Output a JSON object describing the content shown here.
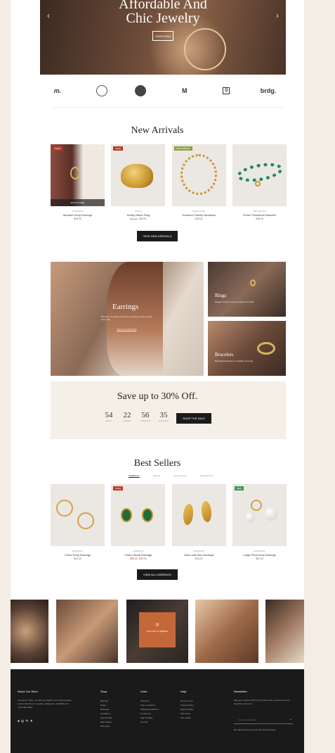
{
  "hero": {
    "title_line1": "Affordable And",
    "title_line2": "Chic Jewelry",
    "button": "SHOP NOW"
  },
  "brands": [
    "m.",
    "",
    "",
    "M",
    "D",
    "brdg."
  ],
  "new_arrivals": {
    "title": "New Arrivals",
    "products": [
      {
        "badge": "SALE",
        "badge_color": "#c0392b",
        "category": "EARRINGS",
        "name": "Medium Hoop Earrings",
        "price": "$35.00",
        "old_price": "",
        "quick": "ADD TO CART"
      },
      {
        "badge": "SALE",
        "badge_color": "#c0392b",
        "category": "RINGS",
        "name": "Smiley Wave Ring",
        "price": "$28.00",
        "old_price": "$32.00"
      },
      {
        "badge": "NEW ARRIVAL",
        "badge_color": "#8fa33a",
        "category": "NECKLACES",
        "name": "Textured Chunky Necklace",
        "price": "$45.00",
        "old_price": ""
      },
      {
        "badge": "",
        "badge_color": "",
        "category": "BRACELETS",
        "name": "Green Gemstone Bracelet",
        "price": "$38.00",
        "old_price": ""
      }
    ],
    "button": "VIEW NEW ARRIVALS"
  },
  "categories": {
    "big": {
      "label": "Earrings",
      "desc": "Discover our latest collection of earrings made to shine every day",
      "link": "SHOP COLLECTION"
    },
    "rings": {
      "label": "Rings",
      "desc": "Elegant rings for every occasion and style"
    },
    "bracelets": {
      "label": "Bracelets",
      "desc": "Beautiful bracelets to complete your look"
    }
  },
  "sale": {
    "title": "Save up to 30% Off.",
    "countdown": [
      {
        "n": "54",
        "u": "DAYS"
      },
      {
        "n": "22",
        "u": "HOURS"
      },
      {
        "n": "56",
        "u": "MINUTES"
      },
      {
        "n": "35",
        "u": "SECONDS"
      }
    ],
    "button": "SHOP THE SALE"
  },
  "best_sellers": {
    "title": "Best Sellers",
    "tabs": [
      "EARRINGS",
      "RINGS",
      "NECKLACES",
      "BRACELETS"
    ],
    "products": [
      {
        "badge": "",
        "badge_color": "",
        "category": "EARRINGS",
        "name": "Circle Hoop Earrings",
        "price": "$24.00",
        "old_price": ""
      },
      {
        "badge": "SALE",
        "badge_color": "#c0392b",
        "category": "EARRINGS",
        "name": "Green Stone Earrings",
        "price": "$30.00",
        "old_price": "$38.00"
      },
      {
        "badge": "",
        "badge_color": "",
        "category": "EARRINGS",
        "name": "Gold Leaf Stud Earrings",
        "price": "$26.00",
        "old_price": ""
      },
      {
        "badge": "NEW",
        "badge_color": "#3a9a5b",
        "category": "EARRINGS",
        "name": "Large Pearl Drop Earrings",
        "price": "$32.00",
        "old_price": ""
      }
    ],
    "button": "VIEW ALL EARRINGS"
  },
  "gallery": {
    "cta_icon": "◎",
    "cta": "FOLLOW US @BRDG"
  },
  "footer": {
    "about": {
      "head": "About Our Store",
      "text": "Founded in Paris, we offer you stylish and modern jewelry pieces. We focus on quality, uniqueness, durability and minimalist ideas."
    },
    "shop": {
      "head": "Shop",
      "links": [
        "Earrings",
        "Rings",
        "Bracelets",
        "Necklaces",
        "New Arrivals",
        "Best Sellers",
        "Gift Cards"
      ]
    },
    "links": {
      "head": "Links",
      "links": [
        "About Us",
        "Store Locations",
        "Shipping & Returns",
        "Contact Us",
        "Help & FAQs",
        "Journal"
      ]
    },
    "help": {
      "head": "Help",
      "links": [
        "Terms of Use",
        "Privacy Policy",
        "Refund Policy",
        "Gift Cards",
        "Size Guide"
      ]
    },
    "newsletter": {
      "head": "Newsletter",
      "text": "Sign up to receive 10% off your first order, exclusive product launches, and more.",
      "placeholder": "Your Email Address",
      "note": "By subscribing you accept the Privacy Policy."
    }
  }
}
